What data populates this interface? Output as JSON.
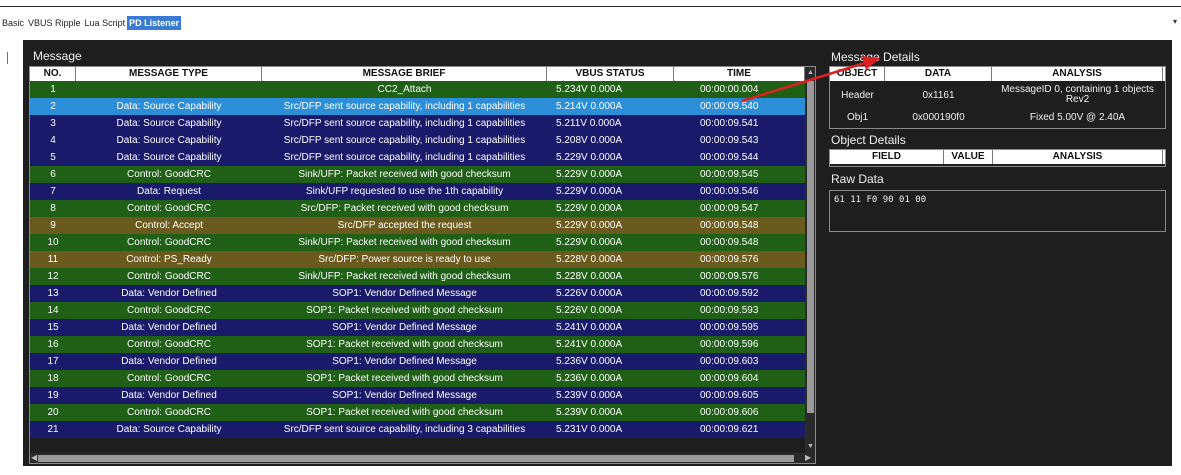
{
  "tabs": [
    {
      "label": "Basic"
    },
    {
      "label": "VBUS Ripple"
    },
    {
      "label": "Lua Script"
    },
    {
      "label": "PD Listener"
    }
  ],
  "tab_menu_glyph": "▾",
  "message": {
    "title": "Message",
    "columns": [
      "NO.",
      "MESSAGE TYPE",
      "MESSAGE BRIEF",
      "VBUS STATUS",
      "TIME"
    ],
    "selected_row": 2,
    "rows": [
      {
        "no": "1",
        "type": "",
        "brief": "CC2_Attach",
        "vbus": "5.234V 0.000A",
        "time": "00:00:00.004",
        "color": "#1f5f16"
      },
      {
        "no": "2",
        "type": "Data: Source Capability",
        "brief": "Src/DFP sent source capability, including 1 capabilities",
        "vbus": "5.214V 0.000A",
        "time": "00:00:09.540",
        "color": "#1a1a6a"
      },
      {
        "no": "3",
        "type": "Data: Source Capability",
        "brief": "Src/DFP sent source capability, including 1 capabilities",
        "vbus": "5.211V 0.000A",
        "time": "00:00:09.541",
        "color": "#1a1a6a"
      },
      {
        "no": "4",
        "type": "Data: Source Capability",
        "brief": "Src/DFP sent source capability, including 1 capabilities",
        "vbus": "5.208V 0.000A",
        "time": "00:00:09.543",
        "color": "#1a1a6a"
      },
      {
        "no": "5",
        "type": "Data: Source Capability",
        "brief": "Src/DFP sent source capability, including 1 capabilities",
        "vbus": "5.229V 0.000A",
        "time": "00:00:09.544",
        "color": "#1a1a6a"
      },
      {
        "no": "6",
        "type": "Control: GoodCRC",
        "brief": "Sink/UFP: Packet received with good checksum",
        "vbus": "5.229V 0.000A",
        "time": "00:00:09.545",
        "color": "#1f5f16"
      },
      {
        "no": "7",
        "type": "Data: Request",
        "brief": "Sink/UFP requested to use the 1th capability",
        "vbus": "5.229V 0.000A",
        "time": "00:00:09.546",
        "color": "#1a1a6a"
      },
      {
        "no": "8",
        "type": "Control: GoodCRC",
        "brief": "Src/DFP: Packet received with good checksum",
        "vbus": "5.229V 0.000A",
        "time": "00:00:09.547",
        "color": "#1f5f16"
      },
      {
        "no": "9",
        "type": "Control: Accept",
        "brief": "Src/DFP accepted the request",
        "vbus": "5.229V 0.000A",
        "time": "00:00:09.548",
        "color": "#6b5a1e"
      },
      {
        "no": "10",
        "type": "Control: GoodCRC",
        "brief": "Sink/UFP: Packet received with good checksum",
        "vbus": "5.229V 0.000A",
        "time": "00:00:09.548",
        "color": "#1f5f16"
      },
      {
        "no": "11",
        "type": "Control: PS_Ready",
        "brief": "Src/DFP: Power source is ready to use",
        "vbus": "5.228V 0.000A",
        "time": "00:00:09.576",
        "color": "#6b5a1e"
      },
      {
        "no": "12",
        "type": "Control: GoodCRC",
        "brief": "Sink/UFP: Packet received with good checksum",
        "vbus": "5.228V 0.000A",
        "time": "00:00:09.576",
        "color": "#1f5f16"
      },
      {
        "no": "13",
        "type": "Data: Vendor Defined",
        "brief": "SOP1: Vendor Defined Message",
        "vbus": "5.226V 0.000A",
        "time": "00:00:09.592",
        "color": "#1a1a6a"
      },
      {
        "no": "14",
        "type": "Control: GoodCRC",
        "brief": "SOP1: Packet received with good checksum",
        "vbus": "5.226V 0.000A",
        "time": "00:00:09.593",
        "color": "#1f5f16"
      },
      {
        "no": "15",
        "type": "Data: Vendor Defined",
        "brief": "SOP1: Vendor Defined Message",
        "vbus": "5.241V 0.000A",
        "time": "00:00:09.595",
        "color": "#1a1a6a"
      },
      {
        "no": "16",
        "type": "Control: GoodCRC",
        "brief": "SOP1: Packet received with good checksum",
        "vbus": "5.241V 0.000A",
        "time": "00:00:09.596",
        "color": "#1f5f16"
      },
      {
        "no": "17",
        "type": "Data: Vendor Defined",
        "brief": "SOP1: Vendor Defined Message",
        "vbus": "5.236V 0.000A",
        "time": "00:00:09.603",
        "color": "#1a1a6a"
      },
      {
        "no": "18",
        "type": "Control: GoodCRC",
        "brief": "SOP1: Packet received with good checksum",
        "vbus": "5.236V 0.000A",
        "time": "00:00:09.604",
        "color": "#1f5f16"
      },
      {
        "no": "19",
        "type": "Data: Vendor Defined",
        "brief": "SOP1: Vendor Defined Message",
        "vbus": "5.239V 0.000A",
        "time": "00:00:09.605",
        "color": "#1a1a6a"
      },
      {
        "no": "20",
        "type": "Control: GoodCRC",
        "brief": "SOP1: Packet received with good checksum",
        "vbus": "5.239V 0.000A",
        "time": "00:00:09.606",
        "color": "#1f5f16"
      },
      {
        "no": "21",
        "type": "Data: Source Capability",
        "brief": "Src/DFP sent source capability, including 3 capabilities",
        "vbus": "5.231V 0.000A",
        "time": "00:00:09.621",
        "color": "#1a1a6a"
      }
    ]
  },
  "details": {
    "title": "Message Details",
    "columns": [
      "OBJECT",
      "DATA",
      "ANALYSIS"
    ],
    "rows": [
      {
        "object": "Header",
        "data": "0x1161",
        "analysis": "MessageID 0, containing 1 objects Rev2"
      },
      {
        "object": "Obj1",
        "data": "0x000190f0",
        "analysis": "Fixed 5.00V @ 2.40A"
      }
    ]
  },
  "object_details": {
    "title": "Object Details",
    "columns": [
      "FIELD",
      "VALUE",
      "ANALYSIS"
    ]
  },
  "raw_data": {
    "title": "Raw Data",
    "value": "61 11 F0 90 01 00"
  },
  "colors": {
    "selected_row": "#2b8ed6",
    "arrow": "#e02020",
    "active_tab": "#3a7bd5"
  }
}
